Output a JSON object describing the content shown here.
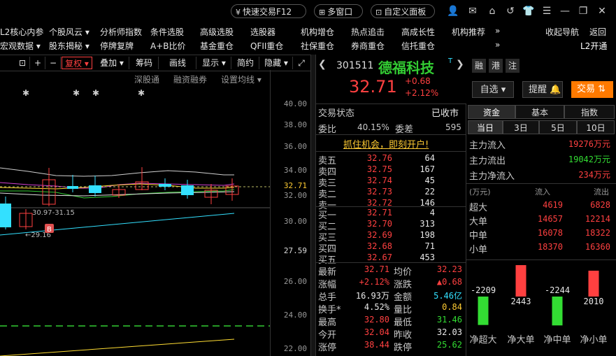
{
  "topbar": {
    "quick_trade": "快速交易F12",
    "multi_window": "多窗口",
    "custom_panel": "自定义面板"
  },
  "nav1": [
    "L2核心内参",
    "个股风云 ▾",
    "分析师指数",
    "条件选股",
    "高级选股",
    "选股器",
    "机构增仓",
    "热点追击",
    "高成长性",
    "机构推荐",
    "»",
    "收起导航",
    "返回"
  ],
  "nav2": [
    "宏观数据 ▾",
    "股东揭秘 ▾",
    "停牌复牌",
    "A+B比价",
    "基金重仓",
    "QFII重仓",
    "社保重仓",
    "券商重仓",
    "信托重仓",
    "»",
    "L2开通"
  ],
  "chart_toolbar": {
    "fuquan": "复权 ▾",
    "overlay": "叠加 ▾",
    "chips": "筹码",
    "draw": "画线",
    "display": "显示 ▾",
    "simple": "简约",
    "hide": "隐藏 ▾"
  },
  "chart_sub": {
    "hk_connect": "深股通",
    "margin": "融资融券",
    "ma_settings": "设置均线 ▾"
  },
  "chart": {
    "ticks": [
      "40.00",
      "38.00",
      "36.00",
      "34.00",
      "32.71",
      "32.00",
      "30.00",
      "27.59",
      "26.00",
      "24.00",
      "22.00"
    ],
    "annotation_range": "30.97-31.15",
    "annotation_low": "←29.16",
    "badge": "B"
  },
  "stock": {
    "code": "301511",
    "name": "德福科技",
    "price": "32.71",
    "change": "+0.68",
    "pct": "+2.12%",
    "tags": [
      "融",
      "港",
      "注"
    ],
    "watch_btn": "自选 ▾",
    "alert_btn": "提醒",
    "trade_btn": "交易"
  },
  "status": {
    "label": "交易状态",
    "value": "已收市"
  },
  "weibi": {
    "label1": "委比",
    "val1": "40.15%",
    "label2": "委差",
    "val2": "595"
  },
  "banner": "抓住机会，即刻开户!",
  "asks": [
    {
      "name": "卖五",
      "price": "32.76",
      "vol": "64"
    },
    {
      "name": "卖四",
      "price": "32.75",
      "vol": "167"
    },
    {
      "name": "卖三",
      "price": "32.74",
      "vol": "45"
    },
    {
      "name": "卖二",
      "price": "32.73",
      "vol": "22"
    },
    {
      "name": "卖一",
      "price": "32.72",
      "vol": "146"
    }
  ],
  "bids": [
    {
      "name": "买一",
      "price": "32.71",
      "vol": "4"
    },
    {
      "name": "买二",
      "price": "32.70",
      "vol": "313"
    },
    {
      "name": "买三",
      "price": "32.69",
      "vol": "198"
    },
    {
      "name": "买四",
      "price": "32.68",
      "vol": "71"
    },
    {
      "name": "买五",
      "price": "32.67",
      "vol": "453"
    }
  ],
  "quote": [
    {
      "n1": "最新",
      "v1": "32.71",
      "c1": "red",
      "n2": "均价",
      "v2": "32.23",
      "c2": "red"
    },
    {
      "n1": "涨幅",
      "v1": "+2.12%",
      "c1": "red",
      "n2": "涨跌",
      "v2": "▲0.68",
      "c2": "red"
    },
    {
      "n1": "总手",
      "v1": "16.93万",
      "c1": "white",
      "n2": "金额",
      "v2": "5.46亿",
      "c2": "cyan"
    },
    {
      "n1": "换手*",
      "v1": "4.52%",
      "c1": "white",
      "n2": "量比",
      "v2": "0.84",
      "c2": "yellow"
    },
    {
      "n1": "最高",
      "v1": "32.80",
      "c1": "red",
      "n2": "最低",
      "v2": "31.46",
      "c2": "green"
    },
    {
      "n1": "今开",
      "v1": "32.04",
      "c1": "red",
      "n2": "昨收",
      "v2": "32.03",
      "c2": "white"
    },
    {
      "n1": "涨停",
      "v1": "38.44",
      "c1": "red",
      "n2": "跌停",
      "v2": "25.62",
      "c2": "green"
    }
  ],
  "fund_tabs": [
    "资金",
    "基本",
    "指数"
  ],
  "period_tabs": [
    "当日",
    "3日",
    "5日",
    "10日"
  ],
  "flows": [
    {
      "label": "主力流入",
      "value": "19276万元"
    },
    {
      "label": "主力流出",
      "value": "19042万元"
    },
    {
      "label": "主力净流入",
      "value": "234万元"
    }
  ],
  "size_header": {
    "unit": "(万元)",
    "in": "流入",
    "out": "流出"
  },
  "sizes": [
    {
      "label": "超大",
      "in": "4619",
      "out": "6828"
    },
    {
      "label": "大单",
      "in": "14657",
      "out": "12214"
    },
    {
      "label": "中单",
      "in": "16078",
      "out": "18322"
    },
    {
      "label": "小单",
      "in": "18370",
      "out": "16360"
    }
  ],
  "chart_data": {
    "type": "bar",
    "categories": [
      "净超大",
      "净大单",
      "净中单",
      "净小单"
    ],
    "values": [
      -2209,
      2443,
      -2244,
      2010
    ],
    "data_labels": [
      "-2209",
      "2443",
      "-2244",
      "2010"
    ]
  },
  "colors": {
    "up": "#ff4040",
    "down": "#33dd33",
    "accent": "#ff7a00",
    "bg": "#000000"
  }
}
